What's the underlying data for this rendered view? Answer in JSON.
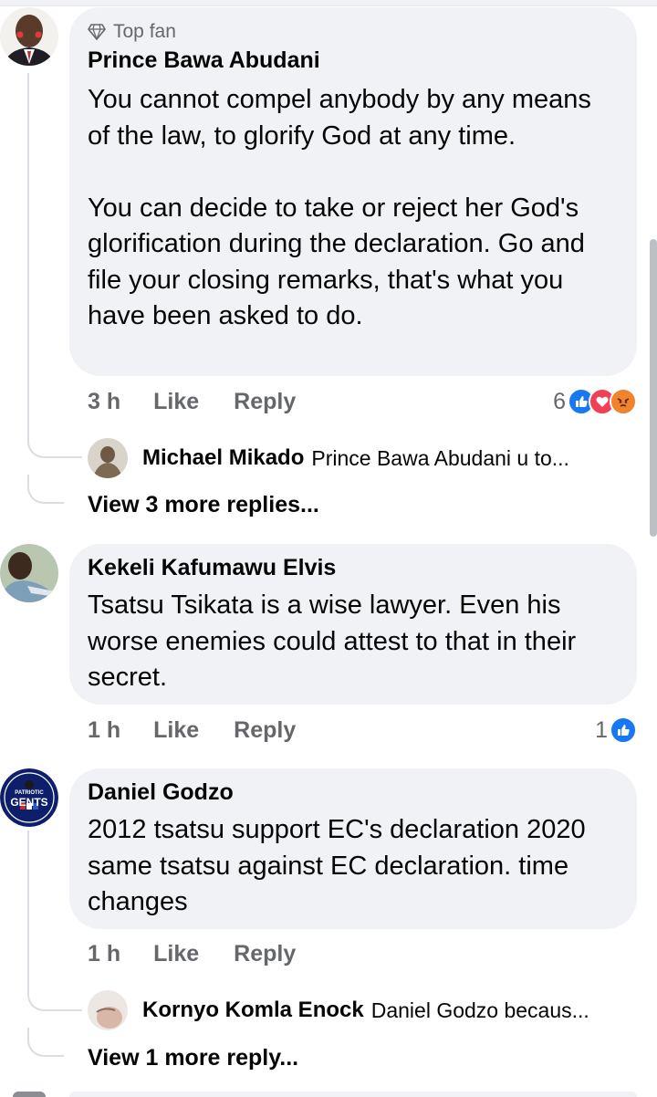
{
  "comments": [
    {
      "badge": "Top fan",
      "author": "Prince Bawa Abudani",
      "paragraphs": [
        "You cannot compel anybody by any means of the law, to glorify God at any time.",
        "You can decide to take or reject her God's glorification during the declaration. Go and file your closing remarks, that's what you have been asked to do."
      ],
      "time": "3 h",
      "like": "Like",
      "reply": "Reply",
      "reaction_count": "6",
      "reaction_icons": [
        "like",
        "love",
        "angry"
      ],
      "reply_preview": {
        "name": "Michael Mikado",
        "snippet": "Prince Bawa Abudani u to..."
      },
      "more_replies": "View 3 more replies..."
    },
    {
      "author": "Kekeli Kafumawu Elvis",
      "paragraphs": [
        "Tsatsu Tsikata is a wise lawyer. Even his worse enemies could attest to that in their secret."
      ],
      "time": "1 h",
      "like": "Like",
      "reply": "Reply",
      "reaction_count": "1",
      "reaction_icons": [
        "like"
      ]
    },
    {
      "author": "Daniel Godzo",
      "avatar_text": [
        "PATRIOTIC",
        "GENTS"
      ],
      "paragraphs": [
        "2012 tsatsu support EC's declaration 2020 same tsatsu against EC declaration. time changes"
      ],
      "time": "1 h",
      "like": "Like",
      "reply": "Reply",
      "reply_preview": {
        "name": "Kornyo Komla Enock",
        "snippet": "Daniel Godzo becaus..."
      },
      "more_replies": "View 1 more reply..."
    }
  ],
  "colors": {
    "bubble": "#f0f2f5",
    "secondary_text": "#65676b",
    "like_blue": "#1877f2",
    "love_red": "#f33e58",
    "angry_orange": "#f0832c"
  }
}
